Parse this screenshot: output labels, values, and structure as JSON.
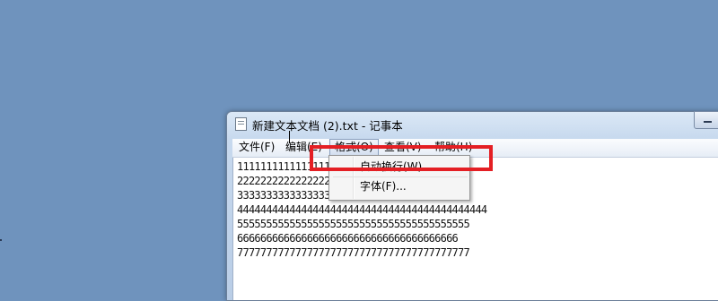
{
  "window": {
    "title": "新建文本文档 (2).txt - 记事本"
  },
  "menubar": {
    "items": [
      {
        "label": "文件(F)"
      },
      {
        "label": "编辑(E)"
      },
      {
        "label": "格式(O)"
      },
      {
        "label": "查看(V)"
      },
      {
        "label": "帮助(H)"
      }
    ]
  },
  "format_menu": {
    "items": [
      {
        "label": "自动换行(W)"
      },
      {
        "label": "字体(F)..."
      }
    ]
  },
  "editor": {
    "lines": [
      "1111111111111111111111111111111111111111",
      "22222222222222222222222222222222222",
      "33333333333333333333333333333333333333",
      "4444444444444444444444444444444444444444444",
      "5555555555555555555555555555555555555555",
      "66666666666666666666666666666666666666",
      "7777777777777777777777777777777777777777"
    ]
  },
  "colors": {
    "desktop": "#6f93bd",
    "highlight_box": "#e41f24"
  }
}
